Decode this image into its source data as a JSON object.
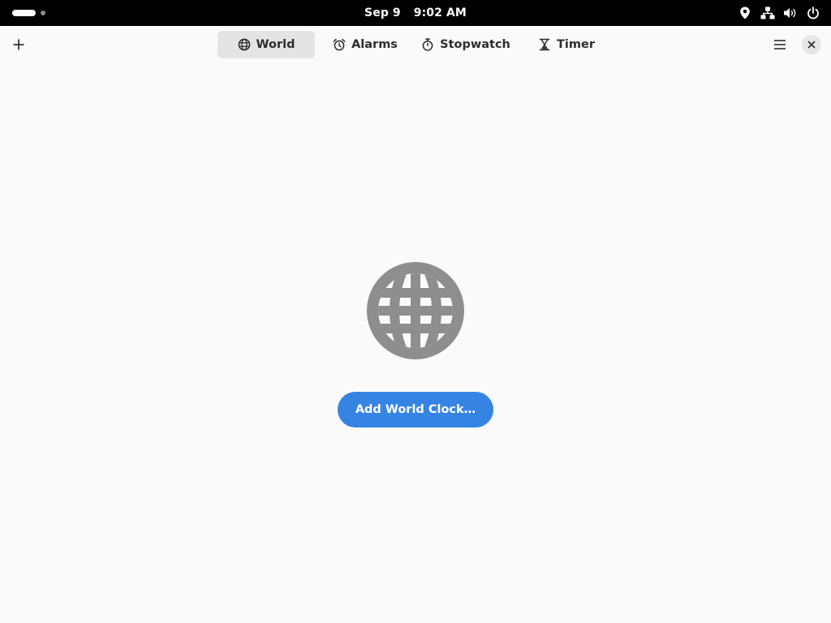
{
  "system_bar": {
    "date": "Sep 9",
    "time": "9:02 AM",
    "tray_icons": [
      "location-icon",
      "network-icon",
      "volume-icon",
      "power-icon"
    ]
  },
  "header": {
    "add_icon": "plus-icon",
    "menu_icon": "hamburger-menu-icon",
    "close_icon": "close-icon",
    "tabs": [
      {
        "label": "World",
        "icon": "globe-icon",
        "active": true
      },
      {
        "label": "Alarms",
        "icon": "alarm-clock-icon",
        "active": false
      },
      {
        "label": "Stopwatch",
        "icon": "stopwatch-icon",
        "active": false
      },
      {
        "label": "Timer",
        "icon": "hourglass-icon",
        "active": false
      }
    ]
  },
  "main": {
    "empty_icon": "globe-icon",
    "add_button_label": "Add World Clock…"
  },
  "colors": {
    "accent": "#3584e4",
    "background": "#fafafa",
    "topbar": "#000000",
    "active_tab": "#e4e4e4",
    "empty_icon": "#8e8e8e"
  }
}
